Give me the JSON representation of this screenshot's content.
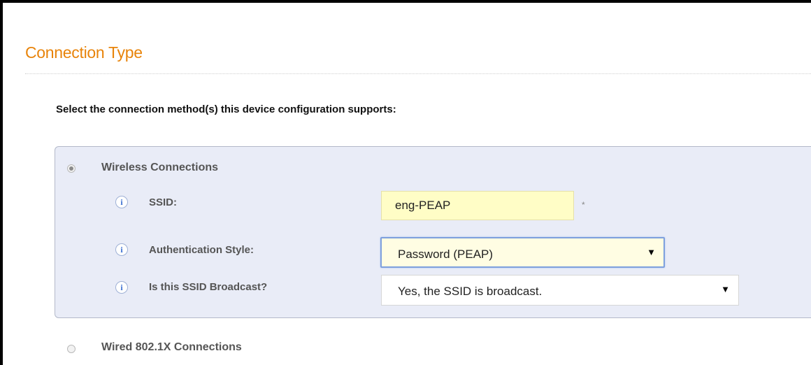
{
  "section": {
    "title": "Connection Type"
  },
  "instructions": "Select the connection method(s) this device configuration supports:",
  "options": {
    "wireless": {
      "label": "Wireless Connections",
      "selected": true
    },
    "wired": {
      "label": "Wired 802.1X Connections",
      "selected": false
    }
  },
  "fields": {
    "info_glyph": "i",
    "ssid": {
      "label": "SSID:",
      "value": "eng-PEAP",
      "required_mark": "*"
    },
    "auth_style": {
      "label": "Authentication Style:",
      "value": "Password (PEAP)",
      "arrow": "▼"
    },
    "broadcast": {
      "label": "Is this SSID Broadcast?",
      "value": "Yes, the SSID is broadcast.",
      "arrow": "▼"
    }
  },
  "colors": {
    "title": "#e8840b",
    "panel_bg": "#e9ecf7",
    "input_highlight": "#fffdc6",
    "info_icon": "#3b6fd1"
  }
}
